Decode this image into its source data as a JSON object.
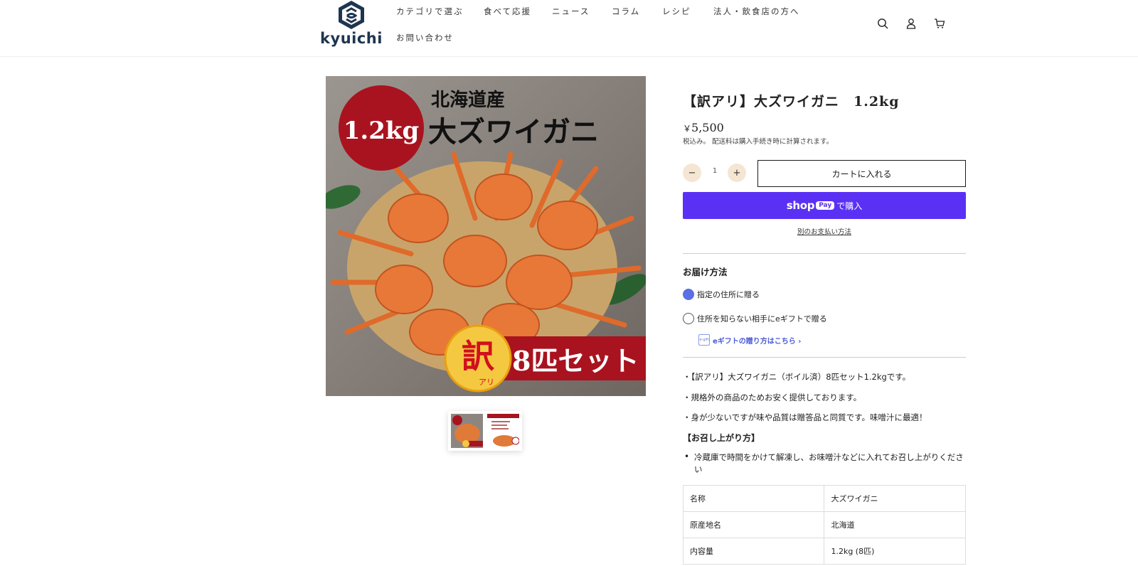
{
  "header": {
    "logo_text": "kyuichi",
    "nav": [
      "カテゴリで選ぶ",
      "食べて応援",
      "ニュース",
      "コラム",
      "レシピ",
      "法人・飲食店の方へ",
      "お問い合わせ"
    ],
    "icons": [
      "search-icon",
      "account-icon",
      "cart-icon"
    ]
  },
  "gallery": {
    "main_image": {
      "top_label": "北海道産",
      "weight_badge": "1.2kg",
      "headline": "大ズワイガニ",
      "wake_char": "訳",
      "wake_sub": "アリ",
      "set_label": "8匹セット"
    },
    "thumbnails": [
      "thumbnail-1",
      "thumbnail-2"
    ]
  },
  "product": {
    "title": "【訳アリ】大ズワイガニ　1.2kg",
    "currency": "￥",
    "price": "5,500",
    "tax_note": "税込み。 配送料は購入手続き時に計算されます。",
    "qty_minus": "−",
    "quantity": "1",
    "qty_plus": "+",
    "add_to_cart": "カートに入れる",
    "shoppay_shop": "shop",
    "shoppay_pay": "Pay",
    "shoppay_buy": "で購入",
    "other_payment": "別のお支払い方法",
    "delivery_title": "お届け方法",
    "delivery_options": [
      {
        "label": "指定の住所に贈る",
        "checked": true
      },
      {
        "label": "住所を知らない相手にeギフトで贈る",
        "checked": false
      }
    ],
    "egift_icon_text": "e-gift",
    "egift_link": "eギフトの贈り方はこちら ›",
    "description": [
      "・【訳アリ】大ズワイガニ（ボイル済）8匹セット1.2kgです。",
      "・規格外の商品のためお安く提供しております。",
      "・身が少ないですが味や品質は贈答品と同質です。味噌汁に最適！"
    ],
    "serving_heading": "【お召し上がり方】",
    "serving_bullet": "冷蔵庫で時間をかけて解凍し、お味噌汁などに入れてお召し上がりください",
    "spec_table": [
      {
        "label": "名称",
        "value": "大ズワイガニ"
      },
      {
        "label": "原産地名",
        "value": "北海道"
      },
      {
        "label": "内容量",
        "value": "1.2kg (8匹)"
      }
    ]
  },
  "colors": {
    "shoppay": "#5a31f4",
    "radio_checked": "#5b6fe6",
    "qty_button_bg": "#f5e6d3",
    "logo_navy": "#1e3550",
    "banner_red": "#a8131f"
  }
}
